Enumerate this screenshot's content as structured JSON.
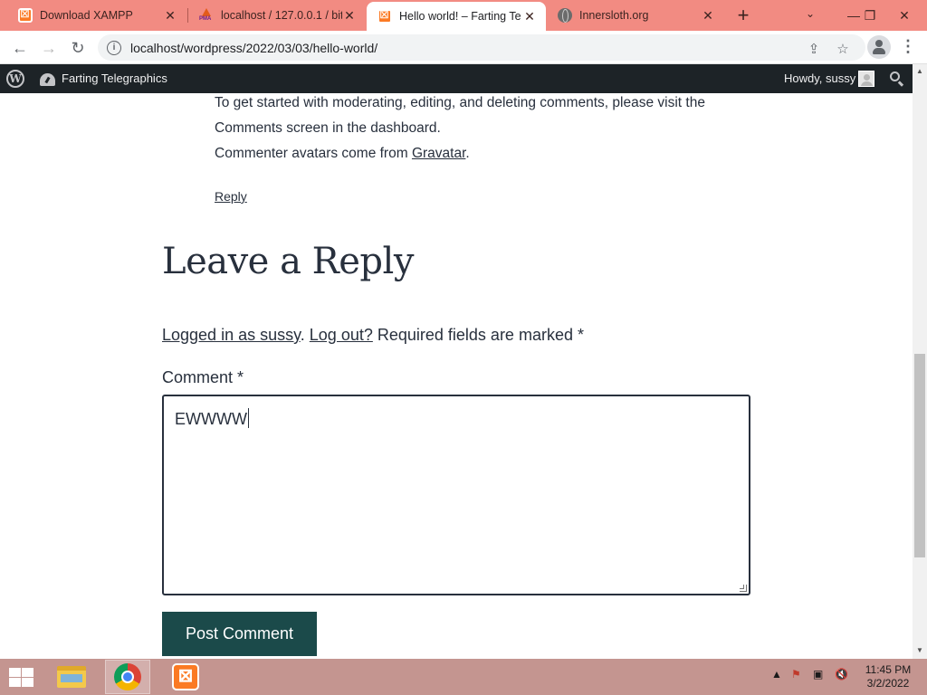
{
  "browser": {
    "tabs": [
      {
        "title": "Download XAMPP",
        "favicon": "xampp-icon",
        "active": false
      },
      {
        "title": "localhost / 127.0.0.1 / bit",
        "favicon": "phpmyadmin-icon",
        "active": false
      },
      {
        "title": "Hello world! – Farting Te",
        "favicon": "xampp-icon",
        "active": true
      },
      {
        "title": "Innersloth.org",
        "favicon": "globe-icon",
        "active": false
      }
    ],
    "url": "localhost/wordpress/2022/03/03/hello-world/"
  },
  "adminbar": {
    "site_name": "Farting Telegraphics",
    "howdy": "Howdy, sussy"
  },
  "comment": {
    "line1": "To get started with moderating, editing, and deleting comments, please visit the",
    "line2": "Comments screen in the dashboard.",
    "avatars_prefix": "Commenter avatars come from ",
    "avatars_link": "Gravatar",
    "avatars_suffix": ".",
    "reply_link": "Reply"
  },
  "reply_form": {
    "title": "Leave a Reply",
    "logged_in_link": "Logged in as sussy",
    "sep": ". ",
    "logout_link": "Log out?",
    "required_note": " Required fields are marked *",
    "comment_label": "Comment *",
    "comment_value": "EWWWW",
    "submit_label": "Post Comment"
  },
  "taskbar": {
    "time": "11:45 PM",
    "date": "3/2/2022"
  },
  "colors": {
    "tabstrip": "#f28b82",
    "adminbar": "#1d2327",
    "button": "#1b4a4a",
    "taskbar": "#c49590",
    "text": "#28303d"
  }
}
